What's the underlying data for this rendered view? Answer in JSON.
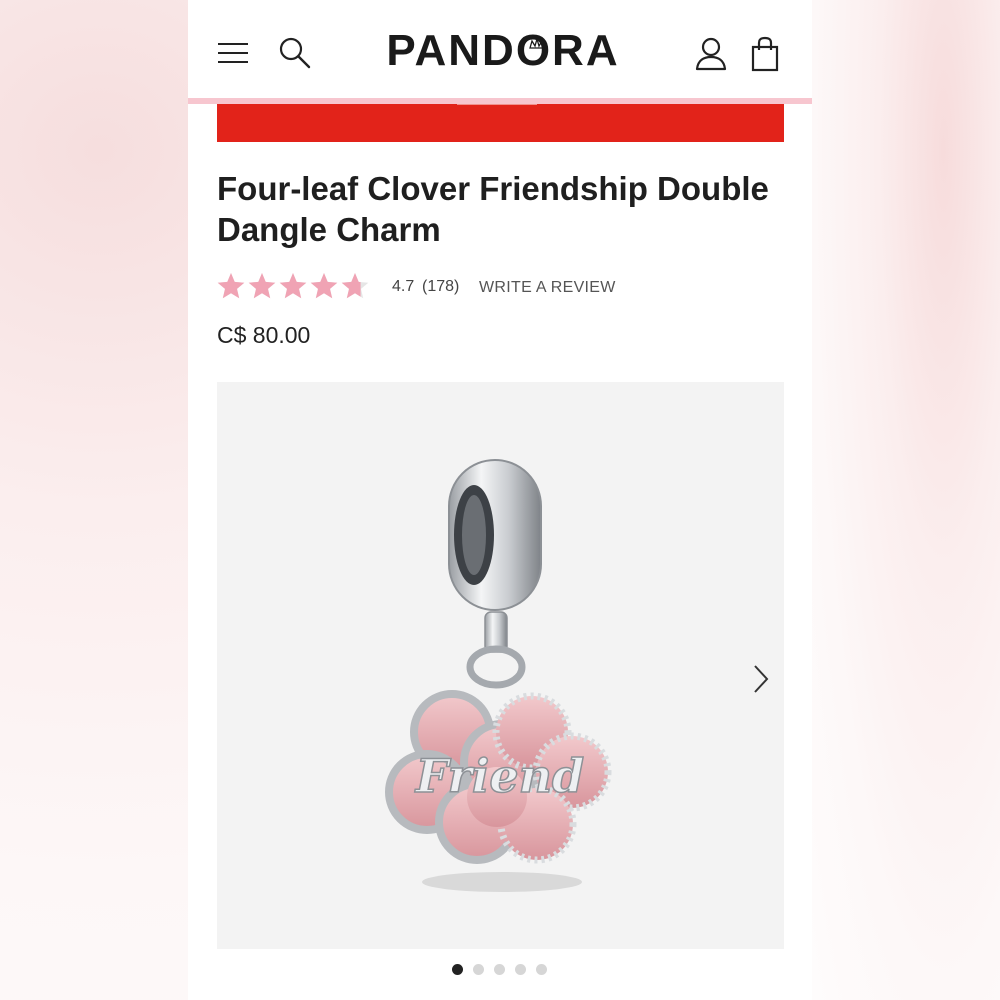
{
  "header": {
    "menu_icon": "menu-icon",
    "search_icon": "search-icon",
    "logo": "PANDORA",
    "account_icon": "account-icon",
    "bag_icon": "shopping-bag-icon"
  },
  "promo": {
    "background": "#e2231a"
  },
  "product": {
    "title": "Four-leaf Clover Friendship Double Dangle Charm",
    "rating": {
      "stars_value": 4.7,
      "value_text": "4.7",
      "count_text": "(178)",
      "star_color": "#f0a3b4",
      "write_review": "WRITE A REVIEW"
    },
    "price": "C$ 80.00",
    "engraving": "Friend"
  },
  "carousel": {
    "next_icon": "chevron-right-icon",
    "dots_count": 5,
    "active_index": 0
  }
}
